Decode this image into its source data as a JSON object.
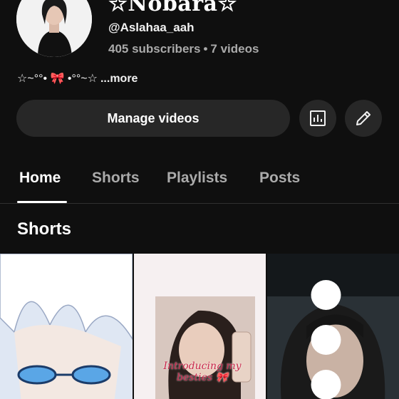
{
  "channel": {
    "name": "☆Nobara☆",
    "handle": "@Aslahaa_aah",
    "subscribers": "405 subscribers",
    "separator": "•",
    "videos": "7 videos",
    "bio": "☆~°°• 🎀 •°°~☆",
    "more_label": "...more"
  },
  "actions": {
    "manage_label": "Manage videos",
    "analytics_icon": "analytics-icon",
    "edit_icon": "pencil-icon"
  },
  "tabs": [
    {
      "label": "Home",
      "active": true
    },
    {
      "label": "Shorts",
      "active": false
    },
    {
      "label": "Playlists",
      "active": false
    },
    {
      "label": "Posts",
      "active": false
    }
  ],
  "sections": {
    "shorts_title": "Shorts"
  },
  "shorts": [
    {
      "thumbnail": "anime-character-thumbnail"
    },
    {
      "thumbnail": "selfie-thumbnail",
      "caption": "Introducing my besties 🎀"
    },
    {
      "thumbnail": "portrait-thumbnail",
      "menu_icon": "more-vertical-icon"
    }
  ],
  "colors": {
    "background": "#0f0f0f",
    "button": "#272727",
    "text_primary": "#f1f1f1",
    "text_secondary": "#aaaaaa"
  }
}
